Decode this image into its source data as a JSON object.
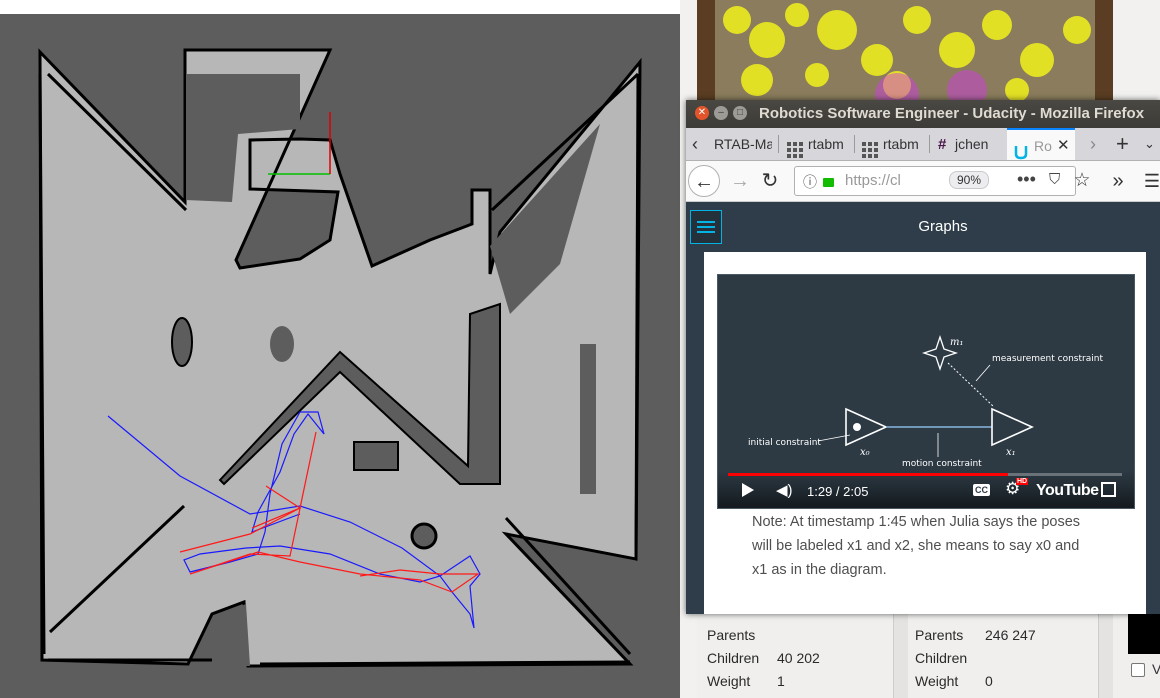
{
  "window": {
    "title": "Robotics Software Engineer - Udacity - Mozilla Firefox"
  },
  "tabs": [
    {
      "label": "RTAB-Ma",
      "icon": "none"
    },
    {
      "label": "rtabm",
      "icon": "grid-icon"
    },
    {
      "label": "rtabm",
      "icon": "grid-icon"
    },
    {
      "label": "jchen",
      "icon": "slack-hash-icon"
    },
    {
      "label": "Ro",
      "icon": "udacity-icon",
      "active": true
    }
  ],
  "toolbar": {
    "url": "https://cl",
    "zoom": "90%"
  },
  "page": {
    "header_title": "Graphs",
    "video": {
      "time": "1:29 / 2:05",
      "progress_fraction": 0.71,
      "youtube_label": "YouTube",
      "hd_badge": "HD",
      "cc_label": "CC",
      "diagram": {
        "landmark_label": "m₁",
        "measurement_label": "measurement constraint",
        "initial_label": "initial constraint",
        "motion_label": "motion constraint",
        "x0_label": "x₀",
        "x1_label": "x₁"
      }
    },
    "note_lines": [
      "Note: At timestamp 1:45 when Julia says the poses",
      "will be labeled x1 and x2, she means to say x0 and",
      "x1 as in the diagram."
    ]
  },
  "info_panel": {
    "left": {
      "parents_label": "Parents",
      "parents_value": "",
      "children_label": "Children",
      "children_value": "40 202",
      "weight_label": "Weight",
      "weight_value": "1"
    },
    "right": {
      "parents_label": "Parents",
      "parents_value": "246 247",
      "children_label": "Children",
      "children_value": "",
      "weight_label": "Weight",
      "weight_value": "0"
    },
    "checkbox_label": "V"
  },
  "colors": {
    "map_unknown": "#5d5d5d",
    "map_free": "#b7b7b7",
    "map_wall": "#000000",
    "path_blue": "#1a1aff",
    "path_red": "#ff1a1a",
    "udacity_dark": "#2e3d49",
    "udacity_blue": "#02b3e4"
  }
}
